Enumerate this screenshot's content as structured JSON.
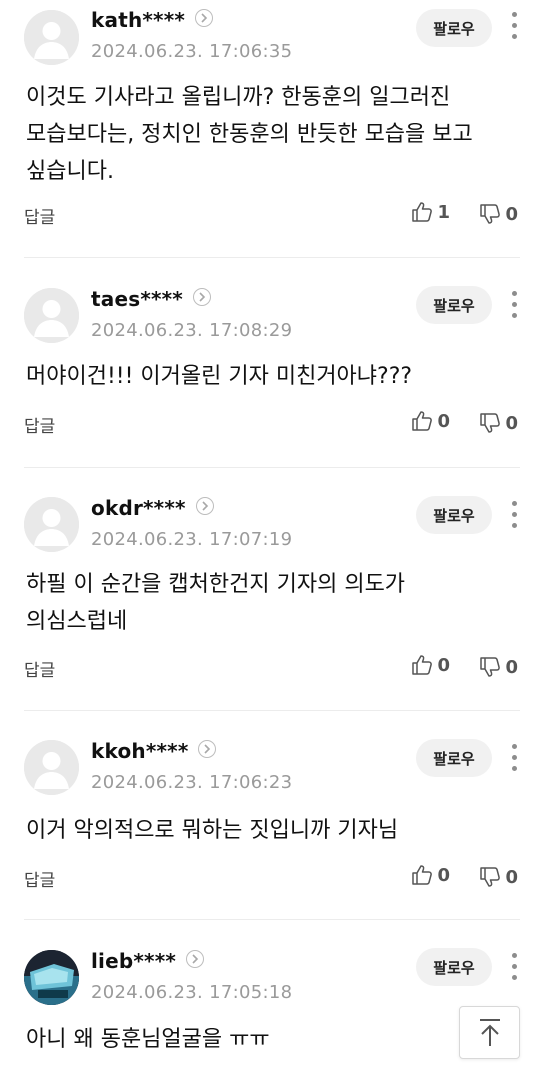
{
  "follow_label": "팔로우",
  "reply_label": "답글",
  "comments": [
    {
      "username": "kath****",
      "date": "2024.06.23. 17:06:35",
      "body": "이것도 기사라고 올립니까? 한동훈의 일그러진 모습보다는, 정치인 한동훈의 반듯한 모습을 보고 싶습니다.",
      "likes": "1",
      "dislikes": "0",
      "avatar": "default"
    },
    {
      "username": "taes****",
      "date": "2024.06.23. 17:08:29",
      "body": "머야이건!!! 이거올린 기자 미친거아냐???",
      "likes": "0",
      "dislikes": "0",
      "avatar": "default"
    },
    {
      "username": "okdr****",
      "date": "2024.06.23. 17:07:19",
      "body": "하필 이 순간을 캡처한건지 기자의 의도가 의심스럽네",
      "likes": "0",
      "dislikes": "0",
      "avatar": "default"
    },
    {
      "username": "kkoh****",
      "date": "2024.06.23. 17:06:23",
      "body": "이거 악의적으로 뭐하는 짓입니까 기자님",
      "likes": "0",
      "dislikes": "0",
      "avatar": "default"
    },
    {
      "username": "lieb****",
      "date": "2024.06.23. 17:05:18",
      "body": "아니 왜 동훈님얼굴을 ㅠㅠ",
      "likes": "",
      "dislikes": "",
      "avatar": "photo"
    }
  ],
  "icons": {
    "profile": "chevron-right-icon",
    "like": "thumbs-up-icon",
    "dislike": "thumbs-down-icon",
    "more": "more-vertical-icon",
    "scroll_top": "arrow-up-icon"
  },
  "colors": {
    "text": "#111111",
    "muted": "#9a9a9a",
    "follow_bg": "#f1f1f1",
    "divider": "#ececec"
  }
}
